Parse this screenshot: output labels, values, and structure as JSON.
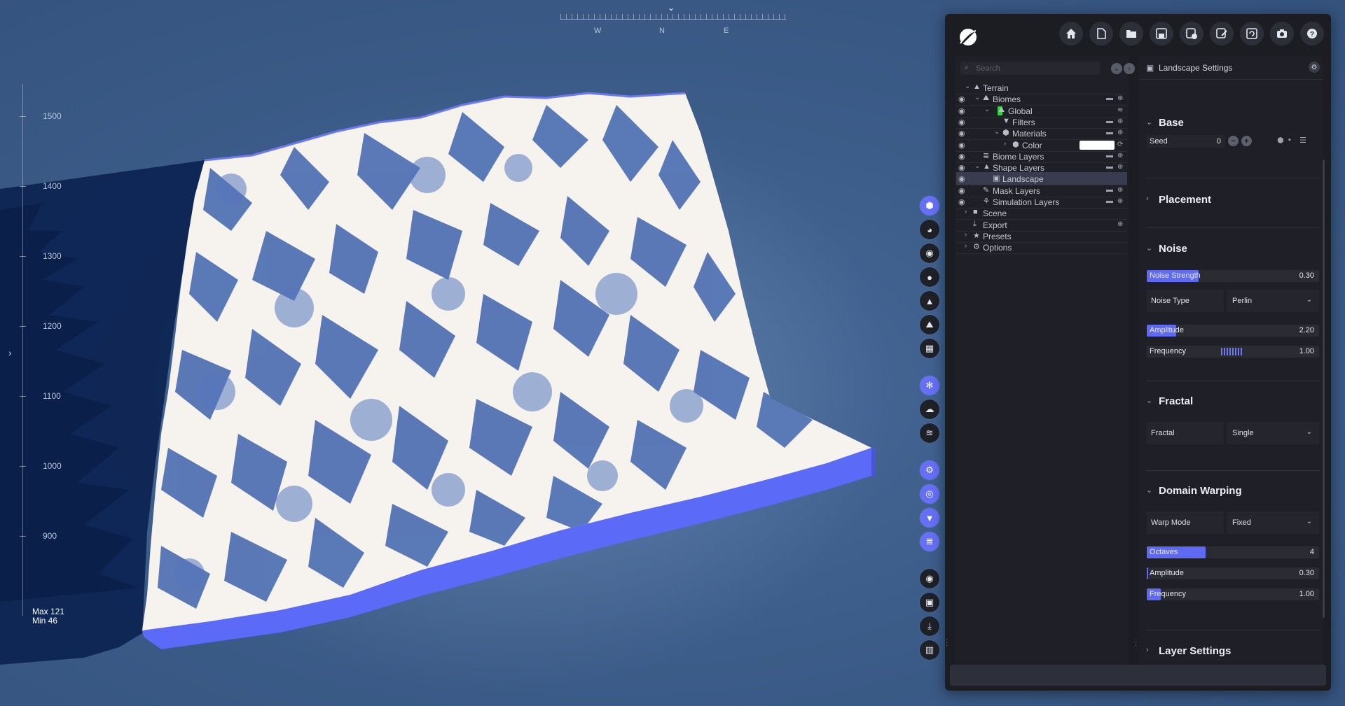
{
  "compass": {
    "west": "W",
    "north": "N",
    "east": "E"
  },
  "ruler": {
    "labels": [
      "1500",
      "1400",
      "1300",
      "1200",
      "1100",
      "1000",
      "900"
    ]
  },
  "stats": {
    "max": "Max 121",
    "min": "Min 46"
  },
  "icons": {
    "collapse": "›",
    "vertical_toolbar": [
      "shape-icon",
      "sphere-icon",
      "target-icon",
      "drop-icon",
      "mountain-icon",
      "landscape-icon",
      "grid-icon",
      "snowflake-icon",
      "cloud-icon",
      "waves-icon",
      "nodes-icon",
      "eye-icon",
      "filter-icon",
      "layers-icon",
      "record-icon",
      "image-icon",
      "download-icon",
      "chart-icon"
    ],
    "top_toolbar": [
      "home-icon",
      "new-file-icon",
      "open-folder-icon",
      "save-icon",
      "export-icon",
      "edit-icon",
      "refresh-icon",
      "camera-icon",
      "help-icon"
    ]
  },
  "colors": {
    "accent": "#6570f6",
    "terrain_base": "#5b6bf8",
    "terrain_shadow": "#0a1f45",
    "terrain_snow": "#f6f3ef",
    "terrain_rock": "#3f63ad",
    "global_chip": "#34d23a"
  },
  "outliner": {
    "search_placeholder": "Search",
    "items": [
      {
        "label": "Terrain",
        "eye": false,
        "chev": "v",
        "depth": 0,
        "folder": false,
        "add": false
      },
      {
        "label": "Biomes",
        "eye": true,
        "chev": "v",
        "depth": 1,
        "folder": true,
        "add": true
      },
      {
        "label": "Global",
        "eye": true,
        "chev": "v",
        "depth": 2,
        "folder": false,
        "add": false
      },
      {
        "label": "Filters",
        "eye": true,
        "chev": "",
        "depth": 3,
        "folder": true,
        "add": true
      },
      {
        "label": "Materials",
        "eye": true,
        "chev": "v",
        "depth": 3,
        "folder": true,
        "add": true
      },
      {
        "label": "Color",
        "eye": true,
        "chev": ">",
        "depth": 4,
        "folder": false,
        "add": false
      },
      {
        "label": "Biome Layers",
        "eye": true,
        "chev": "",
        "depth": 1,
        "folder": true,
        "add": true
      },
      {
        "label": "Shape Layers",
        "eye": true,
        "chev": "v",
        "depth": 1,
        "folder": true,
        "add": true
      },
      {
        "label": "Landscape",
        "eye": true,
        "chev": "",
        "depth": 2,
        "folder": false,
        "add": false
      },
      {
        "label": "Mask Layers",
        "eye": true,
        "chev": "",
        "depth": 1,
        "folder": true,
        "add": true
      },
      {
        "label": "Simulation Layers",
        "eye": true,
        "chev": "",
        "depth": 1,
        "folder": true,
        "add": true
      },
      {
        "label": "Scene",
        "eye": false,
        "chev": ">",
        "depth": 0,
        "folder": false,
        "add": false
      },
      {
        "label": "Export",
        "eye": false,
        "chev": "",
        "depth": 0,
        "folder": false,
        "add": true
      },
      {
        "label": "Presets",
        "eye": false,
        "chev": ">",
        "depth": 0,
        "folder": false,
        "add": false
      },
      {
        "label": "Options",
        "eye": false,
        "chev": ">",
        "depth": 0,
        "folder": false,
        "add": false
      }
    ]
  },
  "settings": {
    "title": "Landscape Settings",
    "sections": {
      "base": "Base",
      "placement": "Placement",
      "noise": "Noise",
      "fractal": "Fractal",
      "domain_warping": "Domain Warping",
      "layer_settings": "Layer Settings"
    },
    "seed": {
      "label": "Seed",
      "value": "0"
    },
    "noise": {
      "strength": {
        "label": "Noise Strength",
        "value": "0.30",
        "fraction": 0.3
      },
      "type": {
        "label": "Noise Type",
        "value": "Perlin"
      },
      "amplitude": {
        "label": "Amplitude",
        "value": "2.20",
        "fraction": 0.17
      },
      "frequency": {
        "label": "Frequency",
        "value": "1.00"
      }
    },
    "fractal": {
      "label": "Fractal",
      "value": "Single"
    },
    "warping": {
      "mode": {
        "label": "Warp Mode",
        "value": "Fixed"
      },
      "octaves": {
        "label": "Octaves",
        "value": "4",
        "fraction": 0.34
      },
      "amplitude": {
        "label": "Amplitude",
        "value": "0.30",
        "fraction": 0.0
      },
      "frequency": {
        "label": "Frequency",
        "value": "1.00",
        "fraction": 0.08
      }
    }
  }
}
